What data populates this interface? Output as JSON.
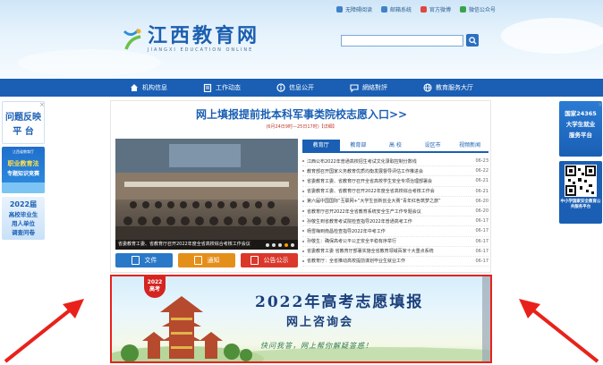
{
  "header": {
    "top_links": [
      {
        "icon": "accessibility-icon",
        "label": "无障碍阅读"
      },
      {
        "icon": "mail-icon",
        "label": "邮箱系统"
      },
      {
        "icon": "weibo-icon",
        "label": "官方微博"
      },
      {
        "icon": "wechat-icon",
        "label": "微信公众号"
      }
    ],
    "logo_cn": "江西教育网",
    "logo_en": "JIANGXI EDUCATION ONLINE",
    "search_placeholder": ""
  },
  "nav": {
    "items": [
      {
        "icon": "home-icon",
        "label": "机构信息"
      },
      {
        "icon": "clipboard-icon",
        "label": "工作动态"
      },
      {
        "icon": "info-icon",
        "label": "信息公开"
      },
      {
        "icon": "chat-icon",
        "label": "網絡對評"
      },
      {
        "icon": "globe-icon",
        "label": "教育服务大厅"
      }
    ]
  },
  "left_side": {
    "feedback_title": "问题反映",
    "feedback_sub": "平 台",
    "law_small": "江西省教育厅",
    "law_line1": "职业教育法",
    "law_line2": "专题知识竞赛",
    "grad_line1": "2022届",
    "grad_line2": "高校毕业生",
    "grad_line3": "用人单位",
    "grad_line4": "调查问卷",
    "close_label": "×"
  },
  "right_side": {
    "platform_line1": "国家24365",
    "platform_line2": "大学生就业",
    "platform_line3": "服务平台",
    "qr_caption": "中小学国家安全教育公共服务平台",
    "close_label": "×"
  },
  "main": {
    "headline": "网上填报提前批本科军事类院校志愿入口>>",
    "subline": "(6月24日9时—25日17时)【详细】",
    "photo_caption": "省委教育工委、省教育厅召开2022年度全省高校综合考核工作会议",
    "slide_count": 5,
    "tabs": [
      "教育厅",
      "教育部",
      "高 校",
      "设区市",
      "视频新闻"
    ],
    "active_tab": 0,
    "news": [
      {
        "title": "江西公布2022年普通高校招生考试文化录取控制分数线",
        "date": "06-23"
      },
      {
        "title": "教育部召开国家义务教育优质均衡发展督导评估工作推进会",
        "date": "06-22"
      },
      {
        "title": "省委教育工委、省教育厅召开全省高校学生安全专项治理部署会",
        "date": "06-21"
      },
      {
        "title": "省委教育工委、省教育厅召开2022年度全省高校综合考核工作会",
        "date": "06-21"
      },
      {
        "title": "第六届中国国际“互联网+”大学生创新创业大赛“青年红色筑梦之旅”",
        "date": "06-20"
      },
      {
        "title": "省教育厅召开2022年全省教育系统安全生产工作专题会议",
        "date": "06-20"
      },
      {
        "title": "孙敬生到省教育考试院检查指导2022年普通高考工作",
        "date": "06-17"
      },
      {
        "title": "杨雪梅到南昌检查指导2022年中考工作",
        "date": "06-17"
      },
      {
        "title": "孙敬生：确保高考公平公正安全平稳有序举行",
        "date": "06-17"
      },
      {
        "title": "省委教育工委 省教育厅部署实施全省教育领域百家十大重点系统",
        "date": "06-17"
      },
      {
        "title": "省教育厅：全省推动高校提前谋划毕业生就业工作",
        "date": "06-17"
      }
    ],
    "quick_buttons": [
      {
        "icon": "document-icon",
        "label": "文件",
        "color": "#2a78c8"
      },
      {
        "icon": "notice-icon",
        "label": "通知",
        "color": "#e58f1b"
      },
      {
        "icon": "bulletin-icon",
        "label": "公告公示",
        "color": "#d9382b"
      }
    ]
  },
  "banner": {
    "badge_year": "2022",
    "badge_label": "高考",
    "title": "2022年高考志愿填报",
    "subtitle": "网上咨询会",
    "slogan": "快问我答，网上帮你解疑答惑！"
  },
  "colors": {
    "brand_blue": "#1a5fb4",
    "accent_red": "#e8221b",
    "accent_orange": "#e58f1b"
  }
}
